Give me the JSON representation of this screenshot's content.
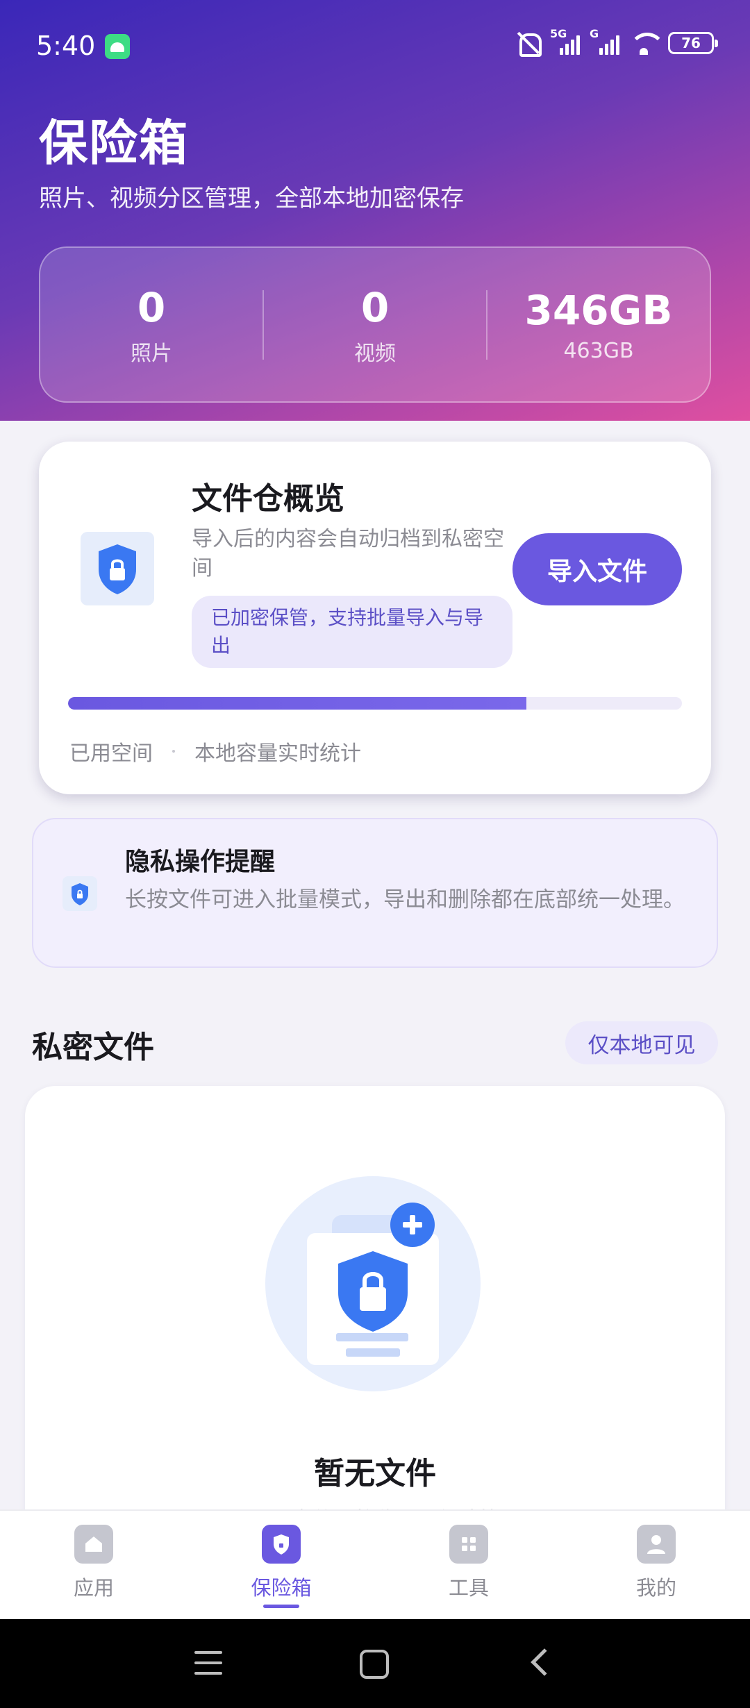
{
  "status_bar": {
    "time": "5:40",
    "network_1": "5G",
    "network_2": "G",
    "battery": "76"
  },
  "header": {
    "title": "保险箱",
    "subtitle": "照片、视频分区管理，全部本地加密保存"
  },
  "stats": [
    {
      "value": "0",
      "label": "照片"
    },
    {
      "value": "0",
      "label": "视频"
    },
    {
      "value": "346GB",
      "label": "463GB"
    }
  ],
  "overview": {
    "title": "文件仓概览",
    "description": "导入后的内容会自动归档到私密空间",
    "pill": "已加密保管，支持批量导入与导出",
    "import_button": "导入文件",
    "usage_fraction": 0.747,
    "usage_label": "已用空间",
    "usage_note": "本地容量实时统计"
  },
  "tip": {
    "title": "隐私操作提醒",
    "text": "长按文件可进入批量模式，导出和删除都在底部统一处理。"
  },
  "files_section": {
    "title": "私密文件",
    "badge": "仅本地可见",
    "empty_title": "暂无文件",
    "empty_subtitle": "导入文件，将收录到保险箱"
  },
  "bottom_nav": [
    {
      "label": "应用",
      "icon": "home-icon",
      "active": false
    },
    {
      "label": "保险箱",
      "icon": "shield-icon",
      "active": true
    },
    {
      "label": "工具",
      "icon": "grid-icon",
      "active": false
    },
    {
      "label": "我的",
      "icon": "person-icon",
      "active": false
    }
  ],
  "colors": {
    "accent": "#6a58e0",
    "shield_blue": "#3a78f2"
  }
}
